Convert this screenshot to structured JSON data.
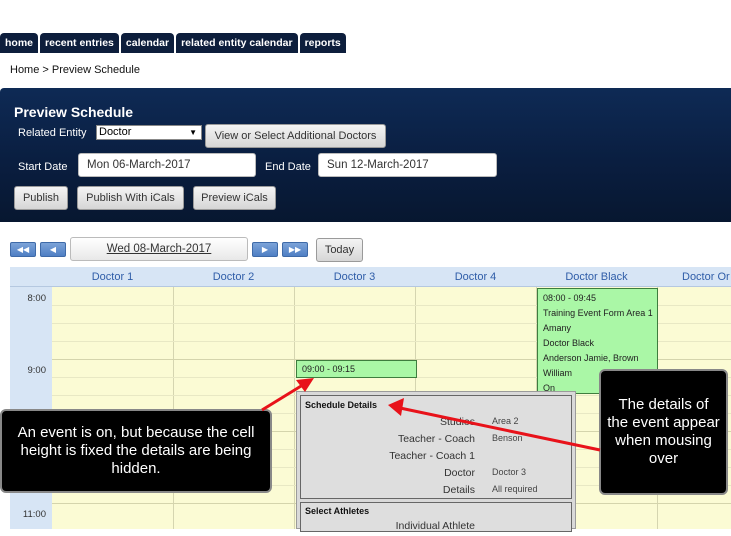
{
  "tabs": [
    "home",
    "recent entries",
    "calendar",
    "related entity calendar",
    "reports"
  ],
  "breadcrumb": {
    "home": "Home",
    "separator": " > ",
    "current": "Preview Schedule"
  },
  "panel": {
    "title": "Preview Schedule",
    "related_entity_label": "Related Entity",
    "related_entity_value": "Doctor",
    "view_button": "View or Select Additional Doctors",
    "start_label": "Start Date",
    "start_value": "Mon 06-March-2017",
    "end_label": "End Date",
    "end_value": "Sun 12-March-2017",
    "buttons": {
      "publish": "Publish",
      "publish_ical": "Publish With iCals",
      "preview_ical": "Preview iCals"
    }
  },
  "date_nav": {
    "first": "◀◀",
    "prev": "◀",
    "date": "Wed 08-March-2017",
    "next": "▶",
    "last": "▶▶",
    "today": "Today"
  },
  "calendar": {
    "columns": [
      "Doctor 1",
      "Doctor 2",
      "Doctor 3",
      "Doctor 4",
      "Doctor Black",
      "Doctor Or"
    ],
    "times": [
      "8:00",
      "9:00",
      "11:00"
    ],
    "event_black": [
      "08:00 - 09:45",
      "Training Event Form Area 1",
      "Amany",
      "Doctor Black",
      "Anderson Jamie, Brown",
      "William",
      "On"
    ],
    "event_hidden": "09:00 - 09:15"
  },
  "popup": {
    "schedule_title": "Schedule Details",
    "rows": [
      {
        "label": "Studios",
        "value": "Area 2"
      },
      {
        "label": "Teacher - Coach",
        "value": "Benson"
      },
      {
        "label": "Teacher - Coach 1",
        "value": ""
      },
      {
        "label": "Doctor",
        "value": "Doctor 3"
      },
      {
        "label": "Details",
        "value": "All required"
      }
    ],
    "athletes_title": "Select Athletes",
    "athletes_row": "Individual Athlete"
  },
  "callouts": {
    "left": "An event is on, but because the cell height is fixed the details are being hidden.",
    "right": "The details of the event appear when mousing over"
  },
  "colors": {
    "nav_dark": "#0d1e3c",
    "event_green": "#aaf7a6",
    "arrow_red": "#e8121a",
    "grid_yellow": "#fbfbd4"
  }
}
